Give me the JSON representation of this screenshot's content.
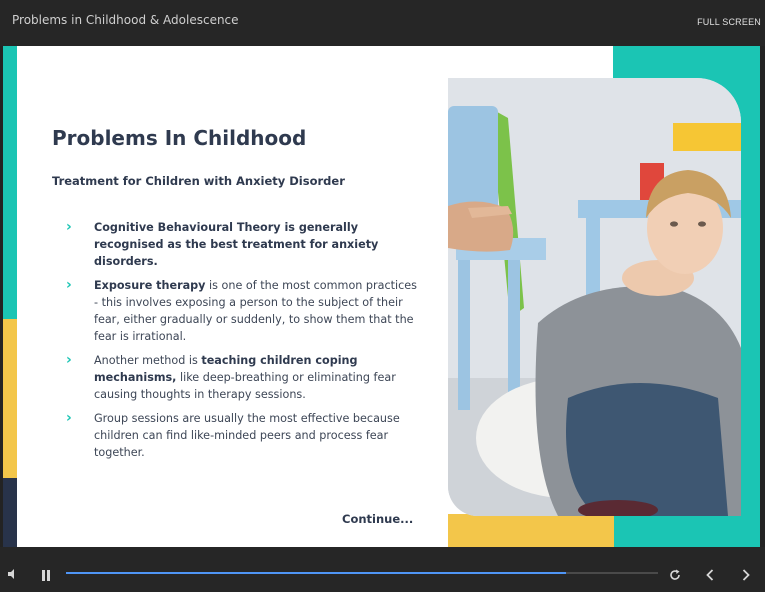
{
  "header": {
    "course_title": "Problems in Childhood & Adolescence",
    "fullscreen_label": "FULL SCREEN"
  },
  "slide": {
    "title": "Problems In Childhood",
    "subtitle": "Treatment for Children with Anxiety Disorder",
    "bullets": [
      {
        "bold_lead": "Cognitive Behavioural Theory is generally recognised as the best treatment for anxiety disorders.",
        "text": ""
      },
      {
        "bold_lead": "Exposure therapy",
        "text": " is one of the most common practices - this involves exposing a person to the subject of their fear, either gradually or suddenly, to show them that the fear is irrational."
      },
      {
        "plain_lead": "Another method is ",
        "bold": "teaching children coping mechanisms,",
        "text": " like deep-breathing or eliminating fear causing thoughts in therapy sessions."
      },
      {
        "bold_lead": "",
        "text": "Group sessions are usually the most effective because children can find like-minded peers and process fear together."
      }
    ],
    "continue_label": "Continue...",
    "image_icon": "boy-therapy-photo"
  },
  "player": {
    "progress_fraction": 0.845,
    "icons": {
      "volume": "volume-icon",
      "pause": "pause-icon",
      "replay": "replay-icon",
      "prev": "chevron-left-icon",
      "next": "chevron-right-icon"
    }
  },
  "colors": {
    "accent_teal": "#1bc5b4",
    "accent_yellow": "#f3c64a",
    "accent_navy": "#28334a",
    "progress_blue": "#4f95f5",
    "text_dark": "#2f3a4f"
  }
}
